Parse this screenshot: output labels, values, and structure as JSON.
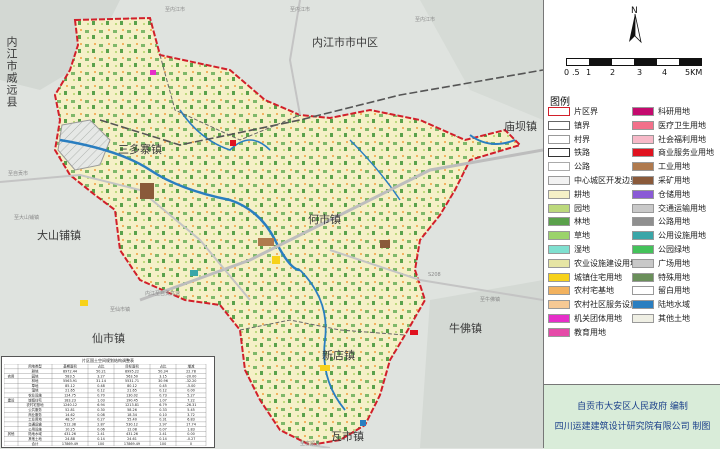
{
  "map": {
    "places": [
      {
        "id": "neijiang-weiyuan",
        "text": "内江市威远县"
      },
      {
        "id": "neijiang-center",
        "text": "内江市市中区"
      },
      {
        "id": "sanduozhai",
        "text": "三多寨镇"
      },
      {
        "id": "heshi",
        "text": "何市镇"
      },
      {
        "id": "miaoba",
        "text": "庙坝镇"
      },
      {
        "id": "dashanpu",
        "text": "大山铺镇"
      },
      {
        "id": "xianshi",
        "text": "仙市镇"
      },
      {
        "id": "niufo",
        "text": "牛佛镇"
      },
      {
        "id": "xindian",
        "text": "新店镇"
      },
      {
        "id": "washi",
        "text": "瓦市镇"
      }
    ],
    "road_labels": [
      {
        "id": "r1",
        "text": "至内江市"
      },
      {
        "id": "r2",
        "text": "至内江市"
      },
      {
        "id": "r3",
        "text": "至内江市"
      },
      {
        "id": "r4",
        "text": "至牛佛镇"
      },
      {
        "id": "r5",
        "text": "至仙市镇"
      },
      {
        "id": "r6",
        "text": "至自贡市"
      },
      {
        "id": "r7",
        "text": "至大山铺镇"
      },
      {
        "id": "r8",
        "text": "S208"
      },
      {
        "id": "r9",
        "text": "内江至自贡高速"
      },
      {
        "id": "r10",
        "text": "至富顺县"
      }
    ],
    "colors": {
      "land": "#f5f0c7",
      "forest": "#7fb86a",
      "water": "#2a7ec0",
      "boundary": "#d21f2a",
      "background": "#dfe3df"
    }
  },
  "table": {
    "title": "片区国土空间规划结构调整表",
    "headers": [
      "",
      "用地类型",
      "基期面积",
      "占比",
      "目标面积",
      "占比",
      "增减"
    ],
    "rows": [
      [
        "",
        "耕地",
        "8972.44",
        "50.21",
        "8995.22",
        "50.34",
        "22.78"
      ],
      [
        "农用",
        "园地",
        "583.5",
        "3.27",
        "563.50",
        "3.15",
        "-20.00"
      ],
      [
        "",
        "林地",
        "5563.91",
        "31.14",
        "5531.71",
        "30.96",
        "-32.20"
      ],
      [
        "",
        "草地",
        "85.12",
        "0.48",
        "80.12",
        "0.45",
        "-5.00"
      ],
      [
        "",
        "湿地",
        "21.65",
        "0.12",
        "21.65",
        "0.12",
        "0.00"
      ],
      [
        "",
        "农业设施",
        "124.75",
        "0.70",
        "130.02",
        "0.73",
        "5.27"
      ],
      [
        "建设",
        "城镇住宅",
        "183.23",
        "1.03",
        "190.45",
        "1.07",
        "7.22"
      ],
      [
        "",
        "农村宅基地",
        "1240.12",
        "6.94",
        "1213.81",
        "6.79",
        "-26.31"
      ],
      [
        "",
        "公共服务",
        "52.81",
        "0.30",
        "58.26",
        "0.33",
        "5.45"
      ],
      [
        "",
        "商业服务",
        "14.62",
        "0.08",
        "18.34",
        "0.10",
        "3.72"
      ],
      [
        "",
        "工业用地",
        "48.57",
        "0.27",
        "55.40",
        "0.31",
        "6.83"
      ],
      [
        "",
        "交通运输",
        "512.38",
        "2.87",
        "530.12",
        "2.97",
        "17.74"
      ],
      [
        "",
        "公用设施",
        "10.25",
        "0.06",
        "12.08",
        "0.07",
        "1.83"
      ],
      [
        "其他",
        "陆地水域",
        "431.26",
        "2.41",
        "431.26",
        "2.41",
        "0.00"
      ],
      [
        "",
        "其他土地",
        "24.88",
        "0.14",
        "24.61",
        "0.14",
        "-0.27"
      ],
      [
        "",
        "合计",
        "17869.49",
        "100",
        "17869.49",
        "100",
        "0"
      ]
    ]
  },
  "panel": {
    "north_label": "N",
    "scale_ticks": [
      "0",
      ".5",
      "1",
      "2",
      "3",
      "4",
      "5KM"
    ],
    "legend_title": "图例",
    "legend": [
      {
        "label": "片区界",
        "color": "#ffffff",
        "border": "#d21f2a"
      },
      {
        "label": "镇界",
        "color": "#ffffff",
        "border": "#666666"
      },
      {
        "label": "村界",
        "color": "#ffffff",
        "border": "#999999"
      },
      {
        "label": "铁路",
        "color": "#ffffff",
        "border": "#333333"
      },
      {
        "label": "公路",
        "color": "#ffffff",
        "border": "#aaaaaa"
      },
      {
        "label": "中心城区开发边界",
        "color": "#f2f2f2",
        "border": "#999999"
      },
      {
        "label": "耕地",
        "color": "#f5f0c7",
        "border": "#999999"
      },
      {
        "label": "园地",
        "color": "#bcd97c",
        "border": "#999999"
      },
      {
        "label": "林地",
        "color": "#5aa14b",
        "border": "#999999"
      },
      {
        "label": "草地",
        "color": "#9bd36b",
        "border": "#999999"
      },
      {
        "label": "湿地",
        "color": "#7fe0d0",
        "border": "#999999"
      },
      {
        "label": "农业设施建设用地",
        "color": "#e6e5a4",
        "border": "#999999"
      },
      {
        "label": "城镇住宅用地",
        "color": "#f7d21a",
        "border": "#999999"
      },
      {
        "label": "农村宅基地",
        "color": "#f2b25f",
        "border": "#999999"
      },
      {
        "label": "农村社区服务设施用地",
        "color": "#f6c994",
        "border": "#999999"
      },
      {
        "label": "机关团体用地",
        "color": "#e62ec9",
        "border": "#999999"
      },
      {
        "label": "教育用地",
        "color": "#e54aa8",
        "border": "#999999"
      },
      {
        "label": "科研用地",
        "color": "#c40a6e",
        "border": "#999999"
      },
      {
        "label": "医疗卫生用地",
        "color": "#f2708a",
        "border": "#999999"
      },
      {
        "label": "社会福利用地",
        "color": "#f7b9c8",
        "border": "#999999"
      },
      {
        "label": "商业服务业用地",
        "color": "#e0121f",
        "border": "#999999"
      },
      {
        "label": "工业用地",
        "color": "#b07a4e",
        "border": "#999999"
      },
      {
        "label": "采矿用地",
        "color": "#8a5a3a",
        "border": "#999999"
      },
      {
        "label": "仓储用地",
        "color": "#8a5ad6",
        "border": "#999999"
      },
      {
        "label": "交通运输用地",
        "color": "#c9c9c9",
        "border": "#999999"
      },
      {
        "label": "公路用地",
        "color": "#8f8f8f",
        "border": "#999999"
      },
      {
        "label": "公用设施用地",
        "color": "#3aa6a8",
        "border": "#999999"
      },
      {
        "label": "公园绿地",
        "color": "#44c25a",
        "border": "#999999"
      },
      {
        "label": "广场用地",
        "color": "#c8c8c8",
        "border": "#999999"
      },
      {
        "label": "特殊用地",
        "color": "#6a8f5a",
        "border": "#999999"
      },
      {
        "label": "留白用地",
        "color": "#ffffff",
        "border": "#999999"
      },
      {
        "label": "陆地水域",
        "color": "#2a7ec0",
        "border": "#999999"
      },
      {
        "label": "其他土地",
        "color": "#efefe4",
        "border": "#999999"
      }
    ],
    "credit_org": "自贡市大安区人民政府  编制",
    "credit_designer": "四川运建建筑设计研究院有限公司  制图"
  }
}
